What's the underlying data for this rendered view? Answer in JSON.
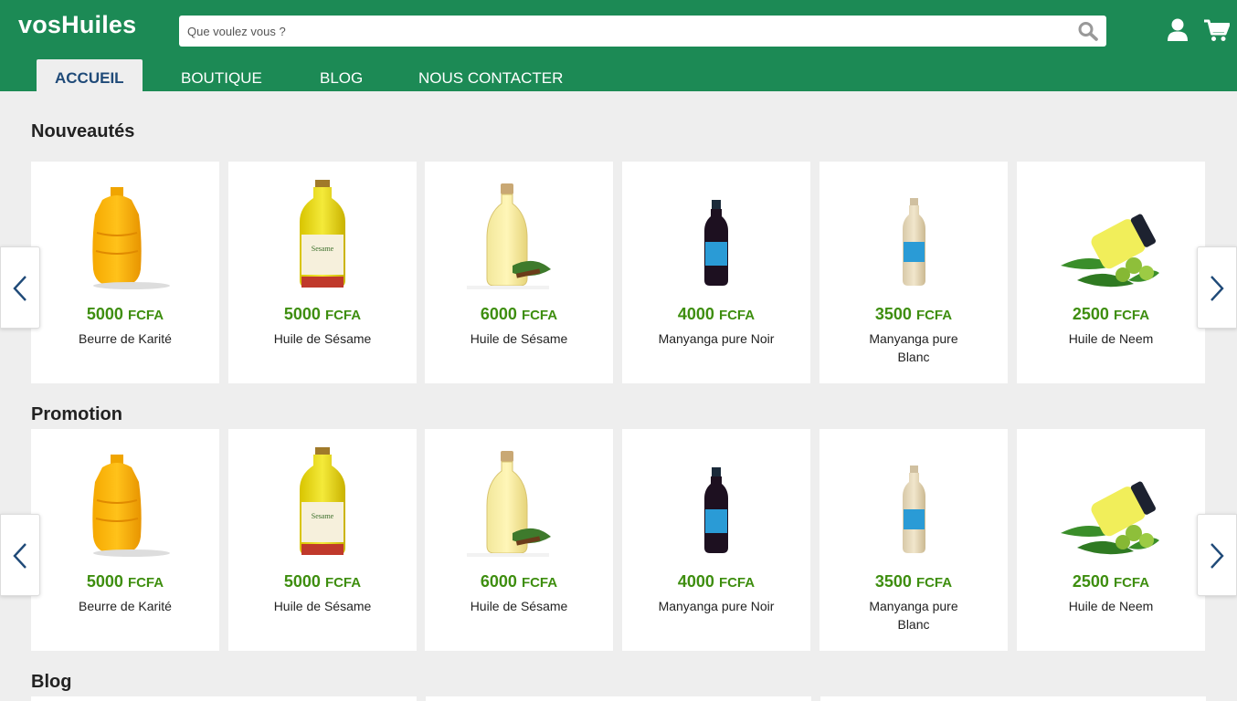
{
  "brand": {
    "name": "vosHuiles",
    "color": "#1c8a55"
  },
  "search": {
    "placeholder": "Que voulez vous ?",
    "icon": "search-icon"
  },
  "header_icons": [
    "user-icon",
    "cart-icon"
  ],
  "nav": {
    "items": [
      "ACCUEIL",
      "BOUTIQUE",
      "BLOG",
      "NOUS CONTACTER"
    ],
    "active": "ACCUEIL"
  },
  "sections": [
    {
      "title": "Nouveautés",
      "products": [
        {
          "price": "5000",
          "currency": "FCFA",
          "name": "Beurre de Karité",
          "image": "shea-butter-jug"
        },
        {
          "price": "5000",
          "currency": "FCFA",
          "name": "Huile de Sésame",
          "image": "sesame-oil-bottle"
        },
        {
          "price": "6000",
          "currency": "FCFA",
          "name": "Huile de Sésame",
          "image": "sesame-oil-glass-bottle"
        },
        {
          "price": "4000",
          "currency": "FCFA",
          "name": "Manyanga pure Noir",
          "image": "dark-oil-bottle"
        },
        {
          "price": "3500",
          "currency": "FCFA",
          "name": "Manyanga pure Blanc",
          "image": "light-oil-bottle"
        },
        {
          "price": "2500",
          "currency": "FCFA",
          "name": "Huile de Neem",
          "image": "neem-oil-jar"
        }
      ]
    },
    {
      "title": "Promotion",
      "products": [
        {
          "price": "5000",
          "currency": "FCFA",
          "name": "Beurre de Karité",
          "image": "shea-butter-jug"
        },
        {
          "price": "5000",
          "currency": "FCFA",
          "name": "Huile de Sésame",
          "image": "sesame-oil-bottle"
        },
        {
          "price": "6000",
          "currency": "FCFA",
          "name": "Huile de Sésame",
          "image": "sesame-oil-glass-bottle"
        },
        {
          "price": "4000",
          "currency": "FCFA",
          "name": "Manyanga pure Noir",
          "image": "dark-oil-bottle"
        },
        {
          "price": "3500",
          "currency": "FCFA",
          "name": "Manyanga pure Blanc",
          "image": "light-oil-bottle"
        },
        {
          "price": "2500",
          "currency": "FCFA",
          "name": "Huile de Neem",
          "image": "neem-oil-jar"
        }
      ]
    },
    {
      "title": "Blog"
    }
  ],
  "colors": {
    "price": "#3e8e0f",
    "nav_active_text": "#1f4a78",
    "background": "#eeeeee"
  }
}
